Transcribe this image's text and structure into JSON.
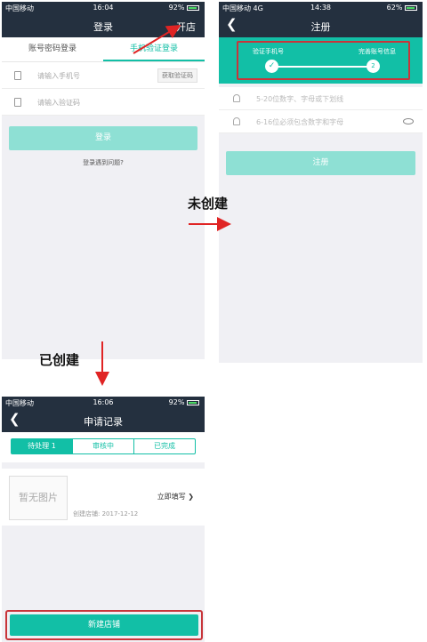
{
  "status": {
    "carrier": "中国移动",
    "carrier_4g": "中国移动  4G",
    "p1_time": "16:04",
    "p2_time": "14:38",
    "p3_time": "16:06",
    "p1_battery": "92%",
    "p2_battery": "62%",
    "p3_battery": "92%"
  },
  "login": {
    "title": "登录",
    "open_store": "开店",
    "tabs": [
      "账号密码登录",
      "手机验证登录"
    ],
    "phone_placeholder": "请输入手机号",
    "sms_button": "获取验证码",
    "code_placeholder": "请输入验证码",
    "login_button": "登录",
    "problem_link": "登录遇到问题?"
  },
  "register": {
    "title": "注册",
    "step1": "验证手机号",
    "step2": "完善账号信息",
    "step2_num": "2",
    "step1_mark": "✓",
    "account_placeholder": "5-20位数字、字母或下划线",
    "password_placeholder": "6-16位必须包含数字和字母",
    "register_button": "注册"
  },
  "records": {
    "title": "申请记录",
    "tabs": [
      "待处理 1",
      "审核中",
      "已完成"
    ],
    "no_image": "暂无图片",
    "created_date": "创建店铺: 2017-12-12",
    "fill_now": "立即填写",
    "new_store_button": "新建店铺"
  },
  "annotations": {
    "not_created": "未创建",
    "created": "已创建"
  },
  "colors": {
    "accent": "#12bfa6",
    "navbar": "#24303f",
    "highlight": "#c8353a",
    "arrow": "#e02424"
  }
}
